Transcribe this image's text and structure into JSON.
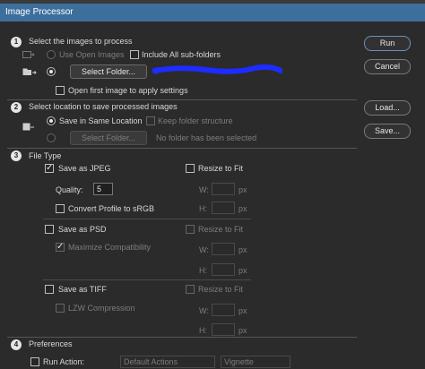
{
  "window": {
    "title": "Image Processor"
  },
  "buttons": {
    "run": "Run",
    "cancel": "Cancel",
    "load": "Load...",
    "save": "Save..."
  },
  "section1": {
    "number": "1",
    "heading": "Select the images to process",
    "use_open_images": "Use Open Images",
    "include_subfolders": "Include All sub-folders",
    "select_folder": "Select Folder...",
    "open_first": "Open first image to apply settings"
  },
  "section2": {
    "number": "2",
    "heading": "Select location to save processed images",
    "save_same": "Save in Same Location",
    "keep_structure": "Keep folder structure",
    "select_folder": "Select Folder...",
    "no_folder": "No folder has been selected"
  },
  "section3": {
    "number": "3",
    "heading": "File Type",
    "jpeg": {
      "save_as": "Save as JPEG",
      "resize": "Resize to Fit",
      "quality_label": "Quality:",
      "quality_value": "5",
      "w": "W:",
      "h": "H:",
      "px": "px",
      "convert": "Convert Profile to sRGB"
    },
    "psd": {
      "save_as": "Save as PSD",
      "resize": "Resize to Fit",
      "maximize": "Maximize Compatibility",
      "w": "W:",
      "h": "H:",
      "px": "px"
    },
    "tiff": {
      "save_as": "Save as TIFF",
      "resize": "Resize to Fit",
      "lzw": "LZW Compression",
      "w": "W:",
      "h": "H:",
      "px": "px"
    }
  },
  "section4": {
    "number": "4",
    "heading": "Preferences",
    "run_action": "Run Action:",
    "action_set": "Default Actions",
    "action": "Vignette (selection)"
  },
  "colors": {
    "accent": "#3d6f9c",
    "highlight_scribble": "#1d2cff"
  }
}
